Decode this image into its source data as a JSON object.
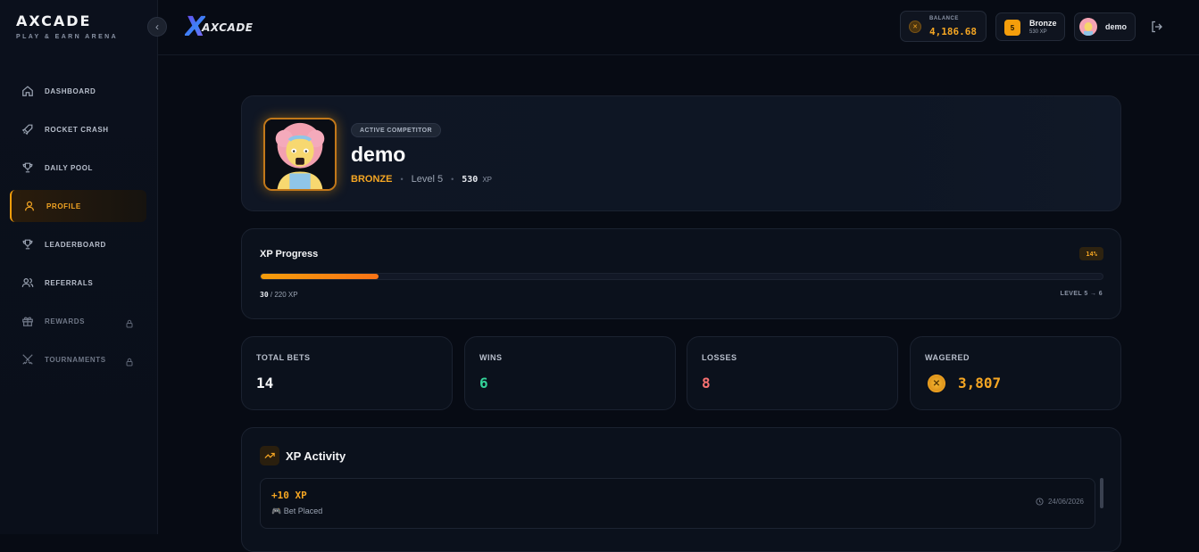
{
  "sidebar": {
    "brand_title": "AXCADE",
    "brand_sub": "PLAY & EARN ARENA",
    "items": [
      {
        "label": "DASHBOARD",
        "icon": "home-icon"
      },
      {
        "label": "ROCKET CRASH",
        "icon": "rocket-icon"
      },
      {
        "label": "DAILY POOL",
        "icon": "trophy-icon"
      },
      {
        "label": "PROFILE",
        "icon": "user-icon",
        "active": true
      },
      {
        "label": "LEADERBOARD",
        "icon": "trophy-icon"
      },
      {
        "label": "REFERRALS",
        "icon": "users-icon"
      },
      {
        "label": "REWARDS",
        "icon": "gift-icon",
        "locked": true
      },
      {
        "label": "TOURNAMENTS",
        "icon": "swords-icon",
        "locked": true
      }
    ]
  },
  "header": {
    "logo_text": "AXCADE",
    "balance_label": "BALANCE",
    "balance_value": "4,186.68",
    "rank_level": "5",
    "rank_name": "Bronze",
    "rank_xp": "530 XP",
    "username": "demo"
  },
  "profile": {
    "chip": "ACTIVE COMPETITOR",
    "name": "demo",
    "tier": "BRONZE",
    "level": "Level 5",
    "xp": "530",
    "xp_unit": "XP"
  },
  "xp_progress": {
    "title": "XP Progress",
    "percent_label": "14%",
    "fraction": 0.14,
    "current": "30",
    "total": "/ 220 XP",
    "level_range": "LEVEL 5 → 6"
  },
  "stats": {
    "total_bets": {
      "label": "TOTAL BETS",
      "value": "14"
    },
    "wins": {
      "label": "WINS",
      "value": "6"
    },
    "losses": {
      "label": "LOSSES",
      "value": "8"
    },
    "wagered": {
      "label": "WAGERED",
      "value": "3,807"
    }
  },
  "activity": {
    "title": "XP Activity",
    "items": [
      {
        "xp": "+10 XP",
        "source": "🎮 Bet Placed",
        "date": "24/06/2026"
      }
    ]
  },
  "colors": {
    "accent": "#f5a623",
    "win": "#34d399",
    "loss": "#f87171",
    "background": "#070b14"
  }
}
